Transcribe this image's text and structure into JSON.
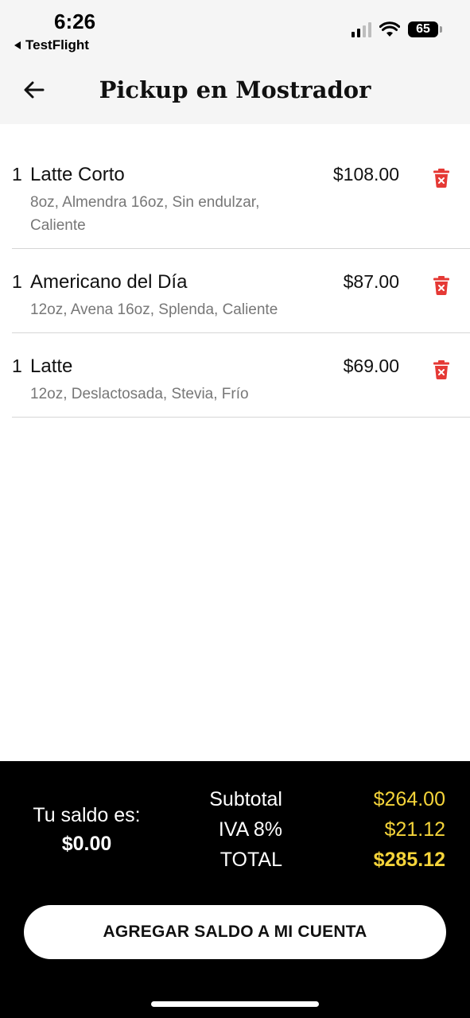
{
  "status_bar": {
    "time": "6:26",
    "back_app": "TestFlight",
    "battery": "65"
  },
  "header": {
    "title": "Pickup en Mostrador"
  },
  "items": [
    {
      "qty": "1",
      "name": "Latte Corto",
      "price": "$108.00",
      "description": "8oz, Almendra 16oz, Sin endulzar, Caliente"
    },
    {
      "qty": "1",
      "name": "Americano del Día",
      "price": "$87.00",
      "description": "12oz, Avena 16oz, Splenda, Caliente"
    },
    {
      "qty": "1",
      "name": "Latte",
      "price": "$69.00",
      "description": "12oz, Deslactosada, Stevia, Frío"
    }
  ],
  "summary": {
    "balance_label": "Tu saldo es:",
    "balance_value": "$0.00",
    "subtotal_label": "Subtotal",
    "subtotal_value": "$264.00",
    "iva_label": "IVA 8%",
    "iva_value": "$21.12",
    "total_label": "TOTAL",
    "total_value": "$285.12"
  },
  "cta": {
    "label": "AGREGAR SALDO A MI CUENTA"
  },
  "colors": {
    "accent_yellow": "#f5d43a",
    "delete_red": "#e53935",
    "footer_bg": "#000000"
  }
}
